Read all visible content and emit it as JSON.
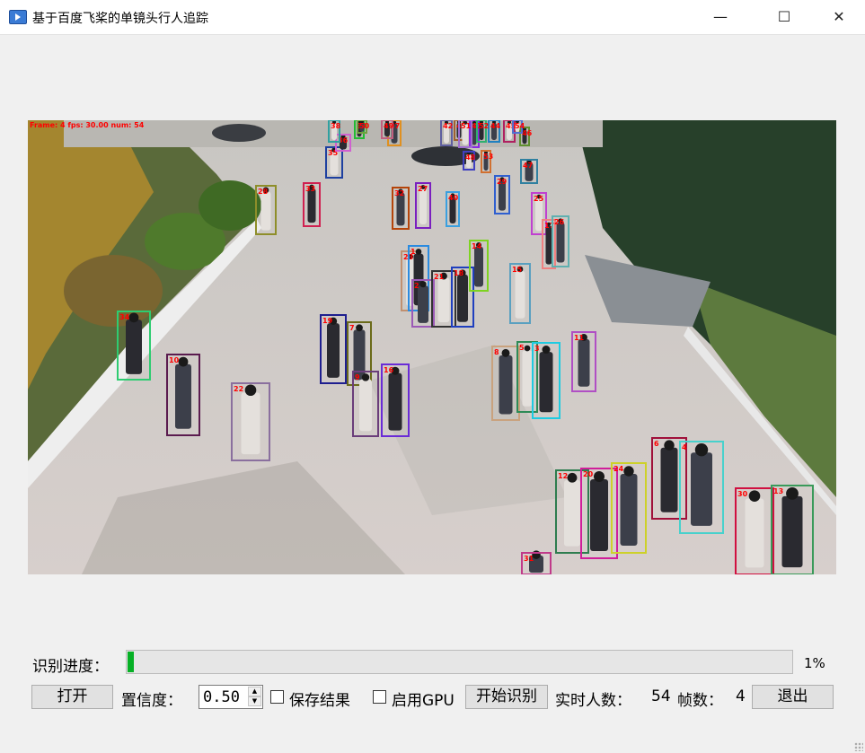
{
  "window": {
    "title": "基于百度飞桨的单镜头行人追踪"
  },
  "video": {
    "overlay_text": "Frame: 4  fps: 30.00  num: 54",
    "boxes": [
      {
        "id": "34",
        "color": "#2ecc71"
      },
      {
        "id": "10",
        "color": "#5b1b4f"
      },
      {
        "id": "22",
        "color": "#8a6f9e"
      },
      {
        "id": "19",
        "color": "#1e1e8f"
      },
      {
        "id": "7",
        "color": "#6b6b1a"
      },
      {
        "id": "9",
        "color": "#6a3d7a"
      },
      {
        "id": "16",
        "color": "#6a2bd6"
      },
      {
        "id": "8",
        "color": "#c9a27e"
      },
      {
        "id": "5",
        "color": "#2e8b57"
      },
      {
        "id": "3",
        "color": "#1ecbe1"
      },
      {
        "id": "11",
        "color": "#b04fc4"
      },
      {
        "id": "23",
        "color": "#c09070"
      },
      {
        "id": "1",
        "color": "#2b8be0"
      },
      {
        "id": "2",
        "color": "#9b59b6"
      },
      {
        "id": "21",
        "color": "#333333"
      },
      {
        "id": "18",
        "color": "#1f3fbf"
      },
      {
        "id": "14",
        "color": "#7ed321"
      },
      {
        "id": "15",
        "color": "#5aa0c0"
      },
      {
        "id": "6",
        "color": "#a0103a"
      },
      {
        "id": "4",
        "color": "#48d1cc"
      },
      {
        "id": "12",
        "color": "#2e7d4f"
      },
      {
        "id": "20",
        "color": "#d01e9a"
      },
      {
        "id": "24",
        "color": "#cdd12a"
      },
      {
        "id": "30",
        "color": "#d01040"
      },
      {
        "id": "13",
        "color": "#3a9a5a"
      },
      {
        "id": "31",
        "color": "#c03a8a"
      },
      {
        "id": "28",
        "color": "#8e8e2a"
      },
      {
        "id": "33",
        "color": "#d02050"
      },
      {
        "id": "32",
        "color": "#b5440a"
      },
      {
        "id": "27",
        "color": "#7a1fbf"
      },
      {
        "id": "40",
        "color": "#3aa0e0"
      },
      {
        "id": "29",
        "color": "#3060d0"
      },
      {
        "id": "25",
        "color": "#c040d0"
      },
      {
        "id": "17",
        "color": "#f08080"
      },
      {
        "id": "26",
        "color": "#5fb0b0"
      },
      {
        "id": "35",
        "color": "#1e40a0"
      },
      {
        "id": "36",
        "color": "#d060d0"
      },
      {
        "id": "37",
        "color": "#e09020"
      },
      {
        "id": "38",
        "color": "#30a0a0"
      },
      {
        "id": "39",
        "color": "#22bb33"
      },
      {
        "id": "41",
        "color": "#8a2be2"
      },
      {
        "id": "42",
        "color": "#6060a0"
      },
      {
        "id": "43",
        "color": "#a06030"
      },
      {
        "id": "44",
        "color": "#2080c0"
      },
      {
        "id": "45",
        "color": "#b02060"
      },
      {
        "id": "46",
        "color": "#609030"
      },
      {
        "id": "47",
        "color": "#3080a0"
      },
      {
        "id": "48",
        "color": "#4040c0"
      },
      {
        "id": "49",
        "color": "#c06080"
      },
      {
        "id": "50",
        "color": "#70a040"
      },
      {
        "id": "51",
        "color": "#a070d0"
      },
      {
        "id": "52",
        "color": "#30b070"
      },
      {
        "id": "53",
        "color": "#d07030"
      },
      {
        "id": "54",
        "color": "#5070d0"
      }
    ]
  },
  "progress": {
    "label": "识别进度：",
    "value": 0.01,
    "percent_text": "1%"
  },
  "controls": {
    "open_label": "打开",
    "confidence_label": "置信度：",
    "confidence_value": "0.50",
    "save_label": "保存结果",
    "gpu_label": "启用GPU",
    "start_label": "开始识别",
    "count_label": "实时人数：",
    "count_value": "54",
    "fps_label": "帧数：",
    "fps_value": "4",
    "exit_label": "退出"
  },
  "colors": {
    "progress_fill": "#06b025",
    "overlay_text": "#ff0000"
  }
}
